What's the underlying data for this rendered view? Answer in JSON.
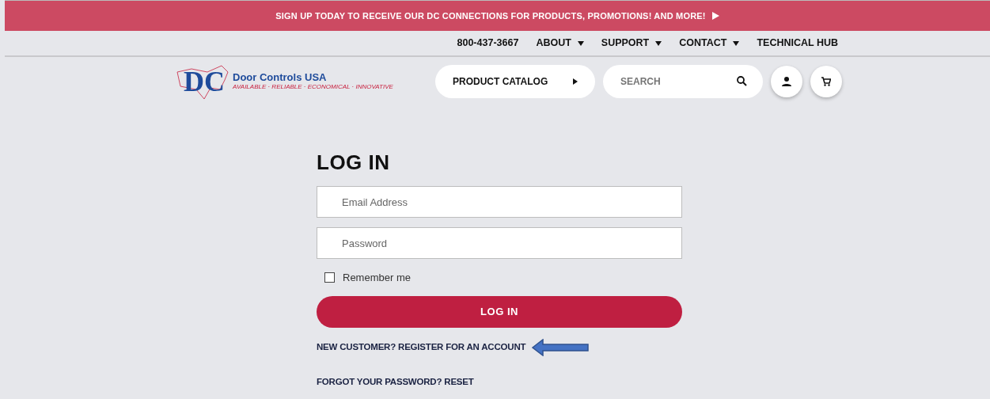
{
  "banner": {
    "text": "SIGN UP TODAY TO RECEIVE OUR DC CONNECTIONS FOR PRODUCTS, PROMOTIONS! AND MORE!"
  },
  "top_nav": [
    {
      "label": "800-437-3667",
      "kind": "link"
    },
    {
      "label": "ABOUT",
      "kind": "dropdown"
    },
    {
      "label": "SUPPORT",
      "kind": "dropdown"
    },
    {
      "label": "CONTACT",
      "kind": "dropdown"
    },
    {
      "label": "TECHNICAL HUB",
      "kind": "link"
    }
  ],
  "logo": {
    "mark": "DC",
    "name": "Door Controls USA",
    "tagline": "AVAILABLE · RELIABLE · ECONOMICAL · INNOVATIVE"
  },
  "catalog_button": {
    "label": "PRODUCT CATALOG"
  },
  "search": {
    "placeholder": "SEARCH"
  },
  "login": {
    "title": "LOG IN",
    "fields": [
      {
        "placeholder": "Email Address"
      },
      {
        "placeholder": "Password"
      }
    ],
    "remember": {
      "label": "Remember me",
      "checked": false
    },
    "submit": "LOG IN",
    "links": [
      {
        "text": "NEW CUSTOMER? REGISTER FOR AN ACCOUNT",
        "annotated": true
      },
      {
        "text": "FORGOT YOUR PASSWORD? RESET",
        "annotated": false
      }
    ]
  }
}
